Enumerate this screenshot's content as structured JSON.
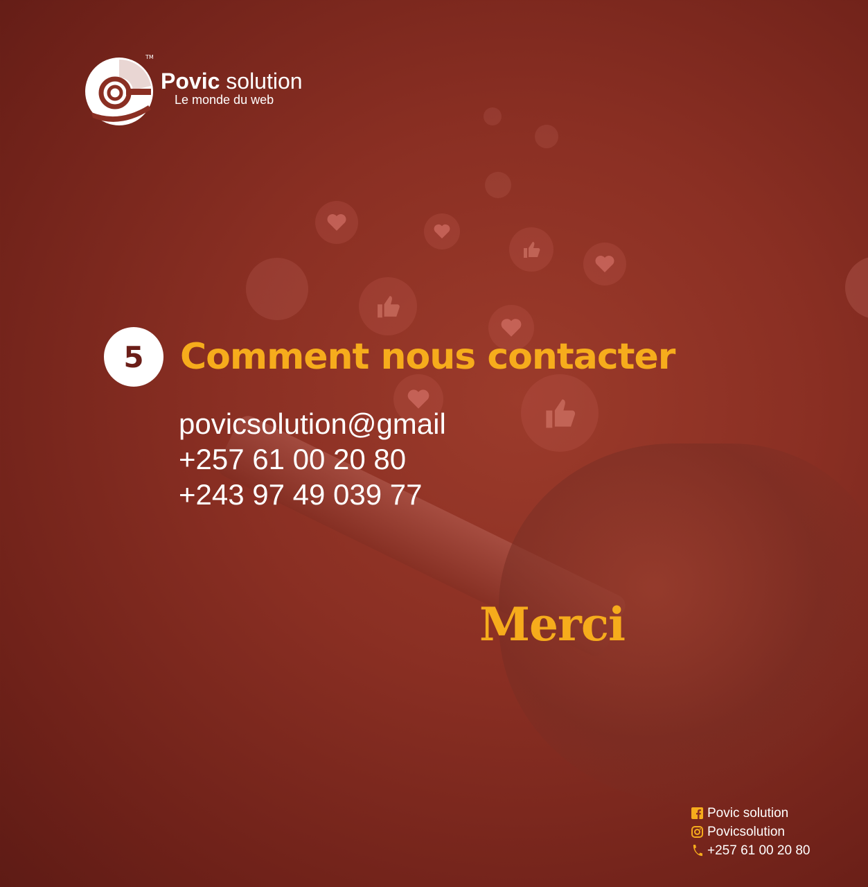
{
  "brand": {
    "name_bold": "Povic",
    "name_light": " solution",
    "tagline": "Le monde du web",
    "trademark": "TM"
  },
  "section": {
    "number": "5",
    "title": "Comment nous contacter"
  },
  "contacts": {
    "email": "povicsolution@gmail",
    "phone_1": "+257 61 00 20 80",
    "phone_2": "+243 97 49 039 77"
  },
  "closing": "Merci",
  "social": {
    "facebook": "Povic solution",
    "instagram": "Povicsolution",
    "phone": "+257 61 00 20 80"
  },
  "colors": {
    "accent": "#f6ac1c",
    "background": "#8a2f23",
    "text": "#ffffff"
  },
  "icons": [
    "facebook-icon",
    "instagram-icon",
    "phone-icon",
    "thumbs-up-icon",
    "heart-icon"
  ]
}
